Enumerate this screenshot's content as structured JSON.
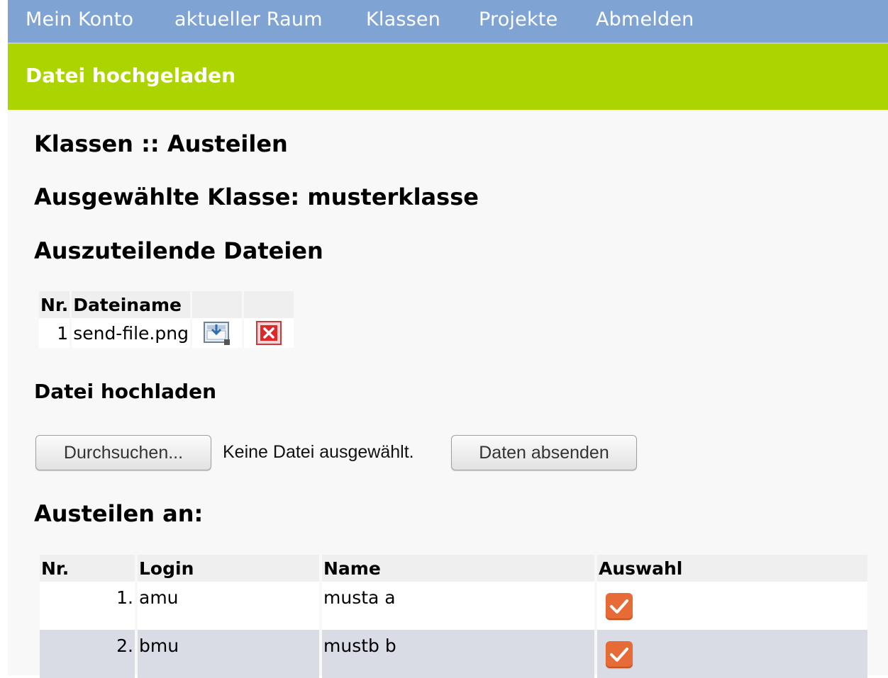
{
  "nav": {
    "items": [
      "Mein Konto",
      "aktueller Raum",
      "Klassen",
      "Projekte",
      "Abmelden"
    ]
  },
  "message": "Datei hochgeladen",
  "headings": {
    "page_title": "Klassen :: Austeilen",
    "selected_class": "Ausgewählte Klasse: musterklasse",
    "files_section": "Auszuteilende Dateien",
    "upload_section": "Datei hochladen",
    "distribute_section": "Austeilen an:"
  },
  "files_table": {
    "columns": [
      "Nr.",
      "Dateiname",
      "",
      ""
    ],
    "rows": [
      {
        "nr": "1",
        "filename": "send-file.png"
      }
    ]
  },
  "upload": {
    "browse_label": "Durchsuchen...",
    "no_file_text": "Keine Datei ausgewählt.",
    "submit_label": "Daten absenden"
  },
  "students_table": {
    "columns": [
      "Nr.",
      "Login",
      "Name",
      "Auswahl"
    ],
    "rows": [
      {
        "nr": "1.",
        "login": "amu",
        "name": "musta a",
        "selected": true
      },
      {
        "nr": "2.",
        "login": "bmu",
        "name": "mustb b",
        "selected": true
      }
    ]
  },
  "colors": {
    "nav_bg": "#7fa4d3",
    "message_bg": "#acd400",
    "checkbox": "#e66b37",
    "row_alt": "#d9dbe5"
  },
  "icons": {
    "download": "download-file-icon",
    "delete": "delete-x-icon",
    "checkbox": "checkmark-icon"
  }
}
